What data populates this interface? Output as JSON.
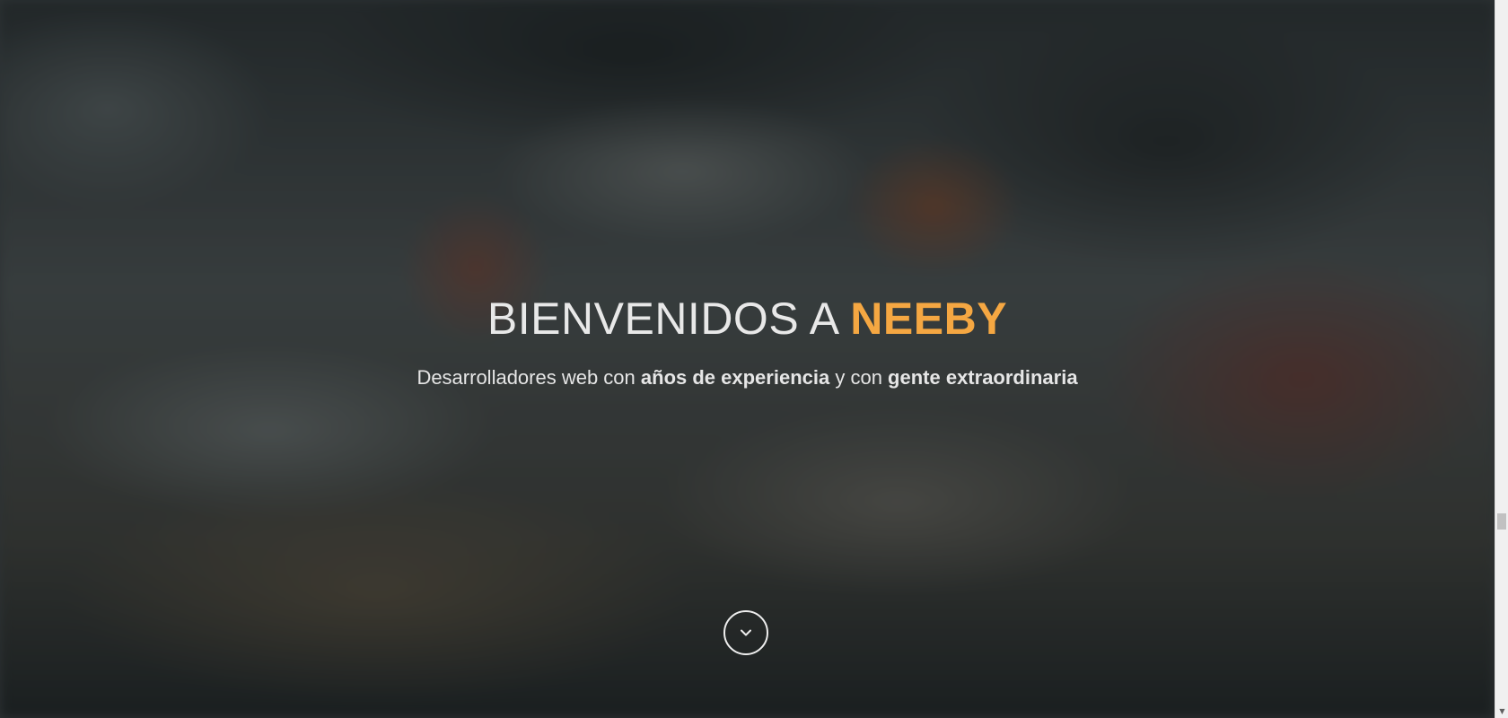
{
  "hero": {
    "title_prefix": "BIENVENIDOS A ",
    "title_brand": "NEEBY",
    "subtitle_part1": "Desarrolladores web con ",
    "subtitle_bold1": "años de experiencia",
    "subtitle_part2": " y con ",
    "subtitle_bold2": "gente extraordinaria",
    "scroll_icon": "chevron-down-icon"
  },
  "colors": {
    "brand_accent": "#f5a742",
    "text": "#e8e8e8",
    "overlay": "#1e2426"
  },
  "scrollbar": {
    "down_arrow": "▼"
  }
}
